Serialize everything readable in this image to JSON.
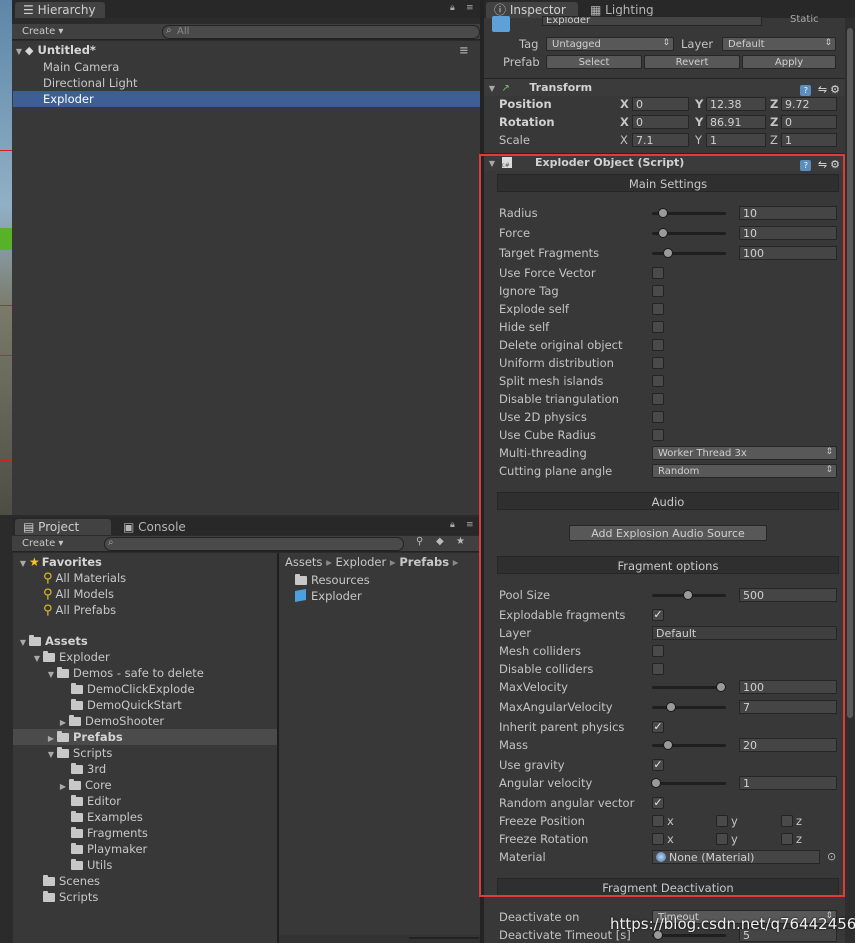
{
  "colors": {
    "selection": "#3e5f96",
    "highlight_box": "#e03a3a",
    "panel": "#383838"
  },
  "hierarchy": {
    "tab": "Hierarchy",
    "create": "Create",
    "search_placeholder": "All",
    "scene": "Untitled*",
    "items": [
      "Main Camera",
      "Directional Light",
      "Exploder"
    ]
  },
  "project": {
    "tab_project": "Project",
    "tab_console": "Console",
    "create": "Create",
    "favorites": {
      "label": "Favorites",
      "items": [
        "All Materials",
        "All Models",
        "All Prefabs"
      ]
    },
    "assets": {
      "label": "Assets",
      "exploder": "Exploder",
      "demos": "Demos - safe to delete",
      "demo_items": [
        "DemoClickExplode",
        "DemoQuickStart",
        "DemoShooter"
      ],
      "prefabs": "Prefabs",
      "scripts": "Scripts",
      "script_items": [
        "3rd",
        "Core",
        "Editor",
        "Examples",
        "Fragments",
        "Playmaker",
        "Utils"
      ],
      "scenes": "Scenes",
      "scripts_root": "Scripts"
    },
    "breadcrumb": [
      "Assets",
      "Exploder",
      "Prefabs"
    ],
    "right_items": [
      "Resources",
      "Exploder"
    ]
  },
  "inspector": {
    "tab_inspector": "Inspector",
    "tab_lighting": "Lighting",
    "object_name": "Exploder",
    "static": "Static",
    "tag_label": "Tag",
    "tag_value": "Untagged",
    "layer_label": "Layer",
    "layer_value": "Default",
    "prefab_label": "Prefab",
    "prefab_buttons": [
      "Select",
      "Revert",
      "Apply"
    ],
    "transform": {
      "title": "Transform",
      "position": {
        "label": "Position",
        "x": "0",
        "y": "12.38",
        "z": "9.72"
      },
      "rotation": {
        "label": "Rotation",
        "x": "0",
        "y": "86.91",
        "z": "0"
      },
      "scale": {
        "label": "Scale",
        "x": "7.1",
        "y": "1",
        "z": "1"
      }
    },
    "exploder": {
      "title": "Exploder Object (Script)",
      "main_settings": "Main Settings",
      "radius": {
        "label": "Radius",
        "value": "10",
        "fill": 0.15
      },
      "force": {
        "label": "Force",
        "value": "10",
        "fill": 0.15
      },
      "target_fragments": {
        "label": "Target Fragments",
        "value": "100",
        "fill": 0.22
      },
      "checks_main": [
        {
          "label": "Use Force Vector",
          "checked": false
        },
        {
          "label": "Ignore Tag",
          "checked": false
        },
        {
          "label": "Explode self",
          "checked": false
        },
        {
          "label": "Hide self",
          "checked": false
        },
        {
          "label": "Delete original object",
          "checked": false
        },
        {
          "label": "Uniform distribution",
          "checked": false
        },
        {
          "label": "Split mesh islands",
          "checked": false
        },
        {
          "label": "Disable triangulation",
          "checked": false
        },
        {
          "label": "Use 2D physics",
          "checked": false
        },
        {
          "label": "Use Cube Radius",
          "checked": false
        }
      ],
      "multithreading": {
        "label": "Multi-threading",
        "value": "Worker Thread 3x"
      },
      "cutting": {
        "label": "Cutting plane angle",
        "value": "Random"
      },
      "audio": "Audio",
      "add_audio": "Add Explosion Audio Source",
      "fragment_options": "Fragment options",
      "pool_size": {
        "label": "Pool Size",
        "value": "500",
        "fill": 0.48
      },
      "explodable": {
        "label": "Explodable fragments",
        "checked": true
      },
      "layer": {
        "label": "Layer",
        "value": "Default"
      },
      "mesh_colliders": {
        "label": "Mesh colliders",
        "checked": false
      },
      "disable_colliders": {
        "label": "Disable colliders",
        "checked": false
      },
      "max_velocity": {
        "label": "MaxVelocity",
        "value": "100",
        "fill": 0.93
      },
      "max_angular": {
        "label": "MaxAngularVelocity",
        "value": "7",
        "fill": 0.25
      },
      "inherit": {
        "label": "Inherit parent physics",
        "checked": true
      },
      "mass": {
        "label": "Mass",
        "value": "20",
        "fill": 0.22
      },
      "use_gravity": {
        "label": "Use gravity",
        "checked": true
      },
      "angular_velocity": {
        "label": "Angular velocity",
        "value": "1",
        "fill": 0.05
      },
      "random_angular": {
        "label": "Random angular vector",
        "checked": true
      },
      "freeze_position": {
        "label": "Freeze Position",
        "x": "x",
        "y": "y",
        "z": "z"
      },
      "freeze_rotation": {
        "label": "Freeze Rotation",
        "x": "x",
        "y": "y",
        "z": "z"
      },
      "material": {
        "label": "Material",
        "value": "None (Material)"
      },
      "fragment_deactivation": "Fragment Deactivation",
      "deactivate_on": {
        "label": "Deactivate on",
        "value": "Timeout"
      },
      "deactivate_timeout": {
        "label": "Deactivate Timeout [s]",
        "value": "5",
        "fill": 0.08
      }
    }
  },
  "watermark": "https://blog.csdn.net/q764424567"
}
